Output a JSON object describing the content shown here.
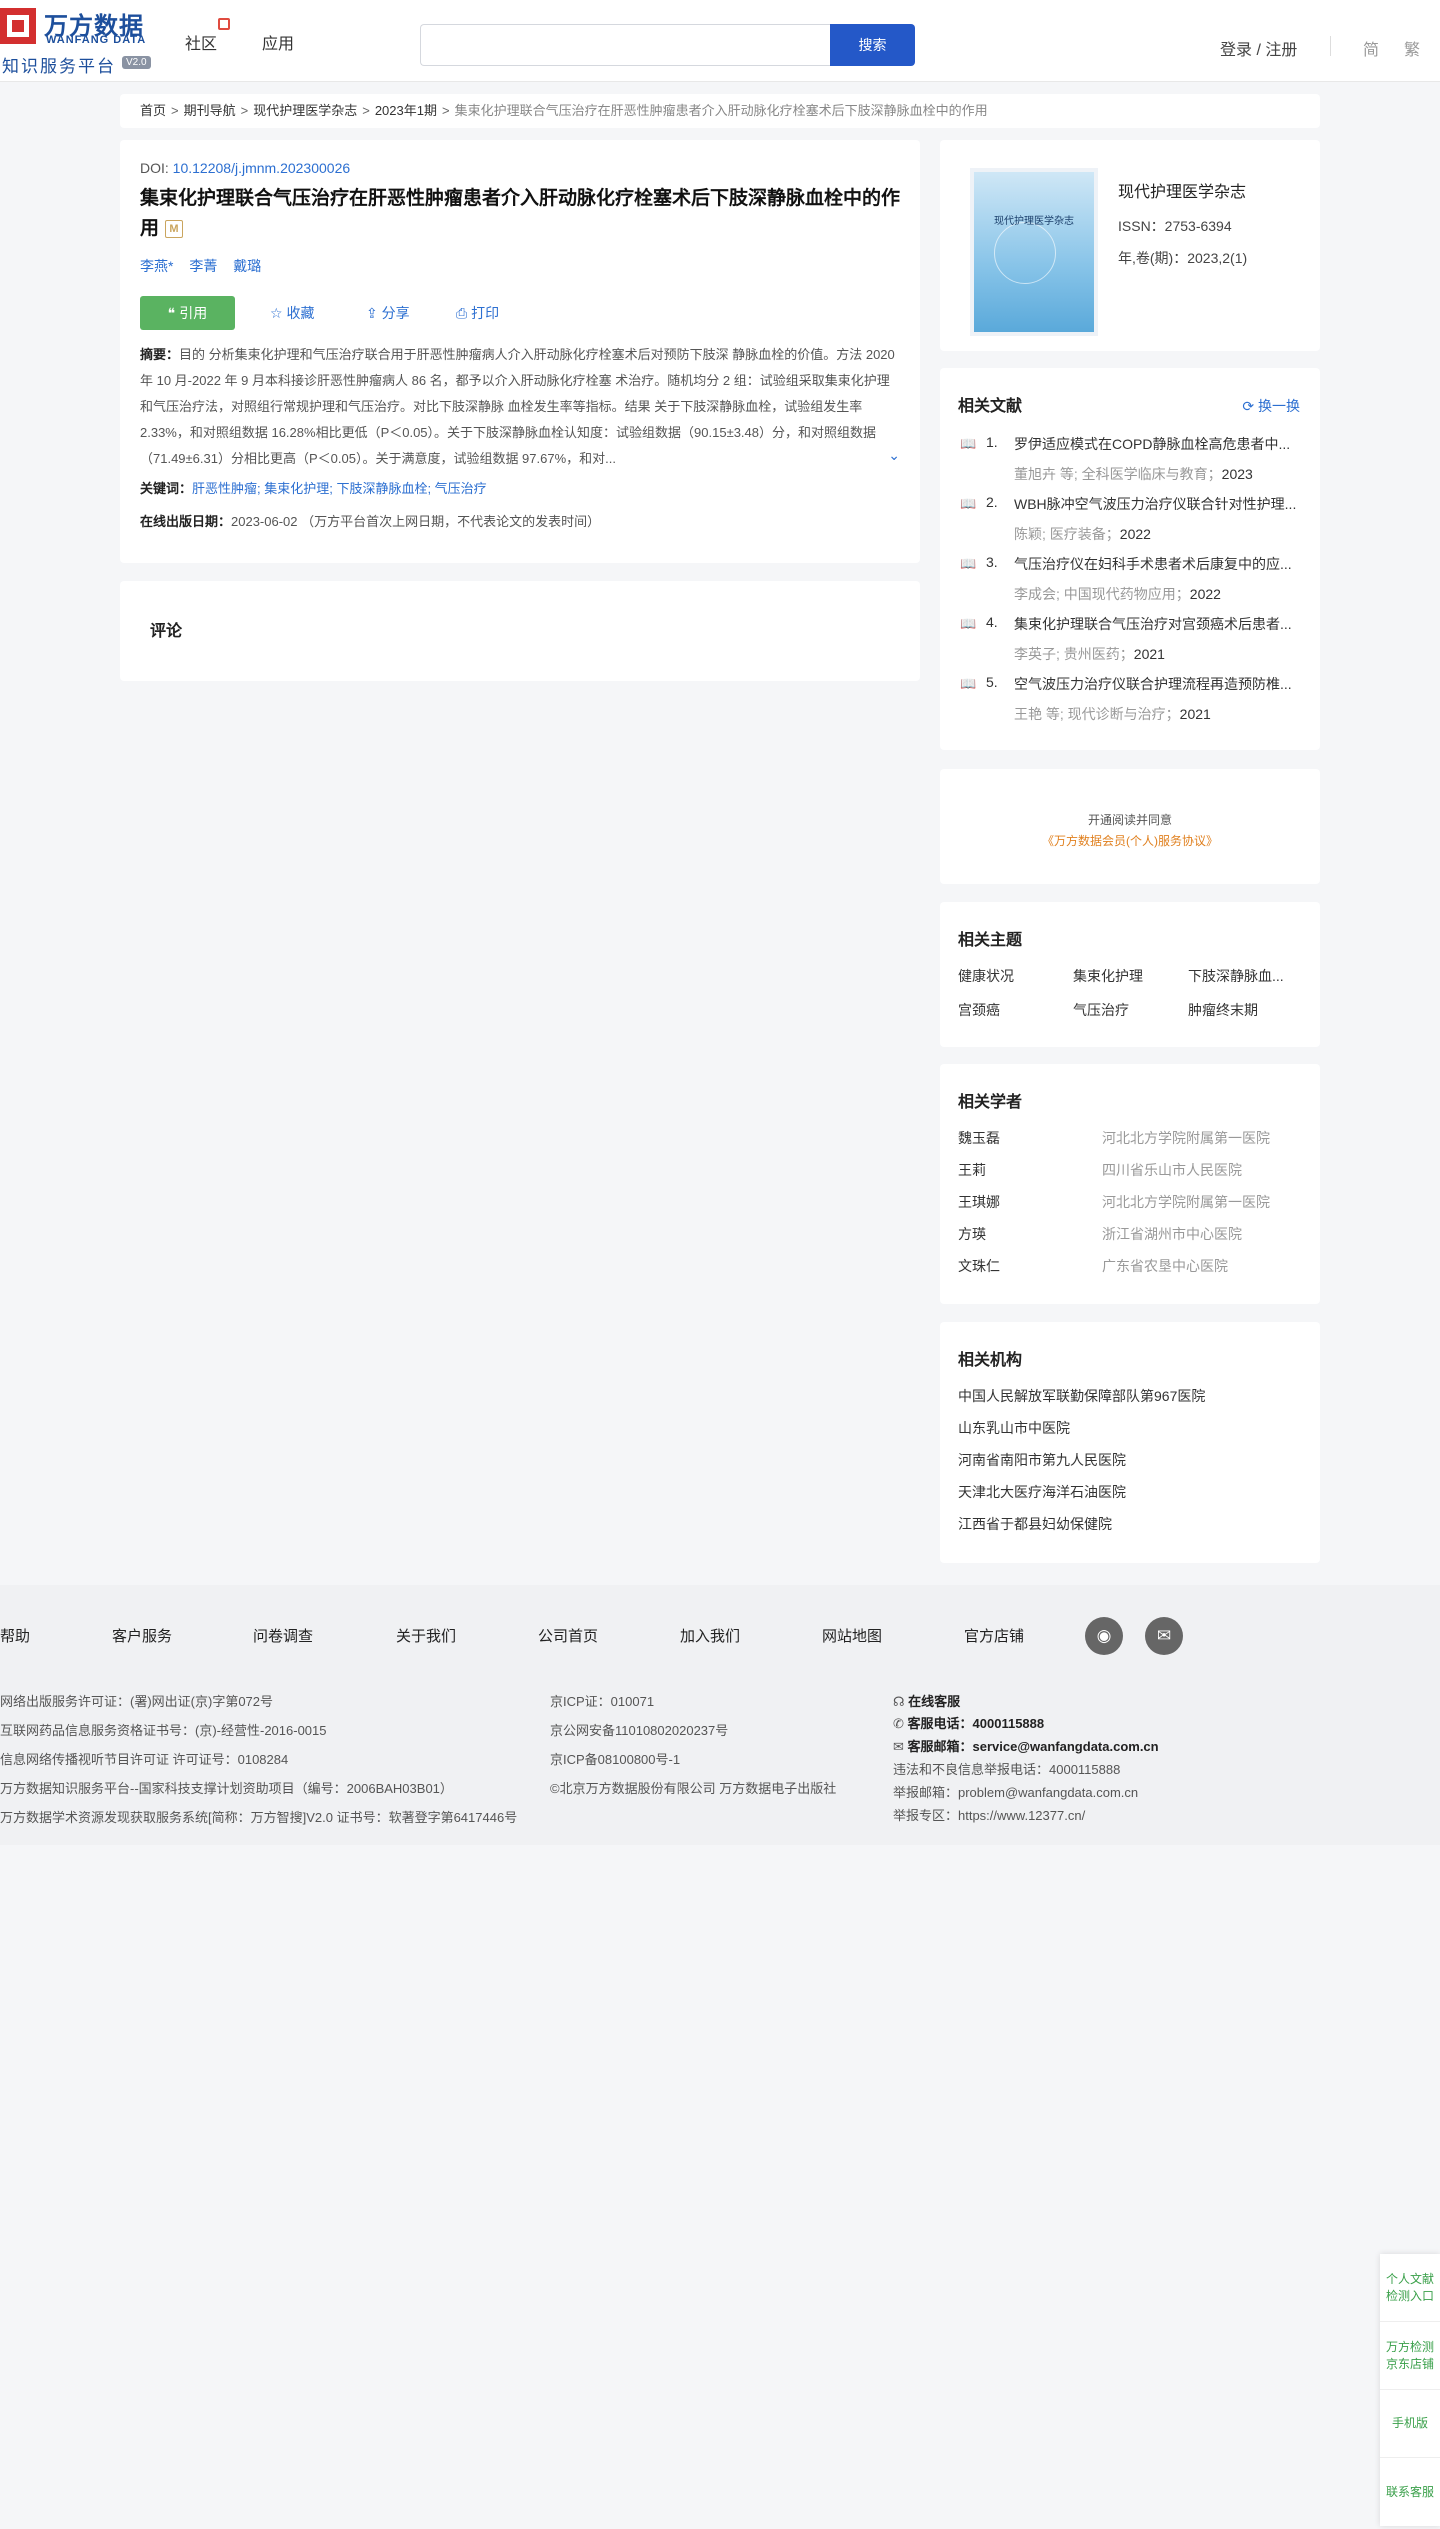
{
  "header": {
    "logo_cn": "万方数据",
    "logo_en": "WANFANG DATA",
    "logo_sub": "知识服务平台",
    "logo_version": "V2.0",
    "nav": [
      "社区",
      "应用"
    ],
    "search_placeholder": "",
    "search_button": "搜索",
    "login": "登录 / 注册",
    "lang_simplified": "简",
    "lang_traditional": "繁"
  },
  "breadcrumb": {
    "items": [
      "首页",
      "期刊导航",
      "现代护理医学杂志",
      "2023年1期"
    ],
    "current": "集束化护理联合气压治疗在肝恶性肿瘤患者介入肝动脉化疗栓塞术后下肢深静脉血栓中的作用"
  },
  "article": {
    "doi_label": "DOI: ",
    "doi": "10.12208/j.jmnm.202300026",
    "title": "集束化护理联合气压治疗在肝恶性肿瘤患者介入肝动脉化疗栓塞术后下肢深静脉血栓中的作用",
    "m_badge": "M",
    "authors": [
      "李燕*",
      "李菁",
      "戴璐"
    ],
    "cite_button": "引用",
    "collect": "收藏",
    "share": "分享",
    "print": "打印",
    "abstract_label": "摘要：",
    "abstract": "目的 分析集束化护理和气压治疗联合用于肝恶性肿瘤病人介入肝动脉化疗栓塞术后对预防下肢深 静脉血栓的价值。方法 2020 年 10 月-2022 年 9 月本科接诊肝恶性肿瘤病人 86 名，都予以介入肝动脉化疗栓塞 术治疗。随机均分 2 组：试验组采取集束化护理和气压治疗法，对照组行常规护理和气压治疗。对比下肢深静脉 血栓发生率等指标。结果 关于下肢深静脉血栓，试验组发生率 2.33%，和对照组数据 16.28%相比更低（P＜0.05）。关于下肢深静脉血栓认知度：试验组数据（90.15±3.48）分，和对照组数据（71.49±6.31）分相比更高（P＜0.05）。关于满意度，试验组数据 97.67%，和对...",
    "keywords_label": "关键词：",
    "keywords": "肝恶性肿瘤; 集束化护理; 下肢深静脉血栓; 气压治疗",
    "pubdate_label": "在线出版日期：",
    "pubdate": "2023-06-02 （万方平台首次上网日期，不代表论文的发表时间）"
  },
  "comment": {
    "title": "评论"
  },
  "journal": {
    "cover_text": "现代护理医学杂志",
    "name": "现代护理医学杂志",
    "issn": "ISSN：2753-6394",
    "volume": "年,卷(期)：2023,2(1)"
  },
  "related": {
    "title": "相关文献",
    "refresh": "换一换",
    "items": [
      {
        "num": "1.",
        "title": "罗伊适应模式在COPD静脉血栓高危患者中...",
        "meta": "董旭卉 等; 全科医学临床与教育；",
        "year": "2023"
      },
      {
        "num": "2.",
        "title": "WBH脉冲空气波压力治疗仪联合针对性护理...",
        "meta": "陈颖; 医疗装备；",
        "year": "2022"
      },
      {
        "num": "3.",
        "title": "气压治疗仪在妇科手术患者术后康复中的应...",
        "meta": "李成会; 中国现代药物应用；",
        "year": "2022"
      },
      {
        "num": "4.",
        "title": "集束化护理联合气压治疗对宫颈癌术后患者...",
        "meta": "李英子; 贵州医药；",
        "year": "2021"
      },
      {
        "num": "5.",
        "title": "空气波压力治疗仪联合护理流程再造预防椎...",
        "meta": "王艳 等; 现代诊断与治疗；",
        "year": "2021"
      }
    ]
  },
  "agreement": {
    "line1": "开通阅读并同意",
    "line2": "《万方数据会员(个人)服务协议》"
  },
  "topics": {
    "title": "相关主题",
    "items": [
      "健康状况",
      "集束化护理",
      "下肢深静脉血...",
      "宫颈癌",
      "气压治疗",
      "肿瘤终末期"
    ]
  },
  "scholars": {
    "title": "相关学者",
    "items": [
      {
        "name": "魏玉磊",
        "org": "河北北方学院附属第一医院"
      },
      {
        "name": "王莉",
        "org": "四川省乐山市人民医院"
      },
      {
        "name": "王琪娜",
        "org": "河北北方学院附属第一医院"
      },
      {
        "name": "方瑛",
        "org": "浙江省湖州市中心医院"
      },
      {
        "name": "文珠仁",
        "org": "广东省农垦中心医院"
      }
    ]
  },
  "orgs": {
    "title": "相关机构",
    "items": [
      "中国人民解放军联勤保障部队第967医院",
      "山东乳山市中医院",
      "河南省南阳市第九人民医院",
      "天津北大医疗海洋石油医院",
      "江西省于都县妇幼保健院"
    ]
  },
  "footer": {
    "links": [
      "帮助",
      "客户服务",
      "问卷调查",
      "关于我们",
      "公司首页",
      "加入我们",
      "网站地图",
      "官方店铺"
    ],
    "col1": [
      "网络出版服务许可证：(署)网出证(京)字第072号",
      "互联网药品信息服务资格证书号：(京)-经营性-2016-0015",
      "信息网络传播视听节目许可证 许可证号：0108284",
      "万方数据知识服务平台--国家科技支撑计划资助项目（编号：2006BAH03B01）",
      "万方数据学术资源发现获取服务系统[简称：万方智搜]V2.0 证书号：软著登字第6417446号"
    ],
    "col2": [
      "京ICP证：010071",
      "京公网安备11010802020237号",
      "京ICP备08100800号-1",
      "©北京万方数据股份有限公司 万方数据电子出版社"
    ],
    "online_service": "在线客服",
    "phone_label": "客服电话：",
    "phone": "4000115888",
    "email_label": "客服邮箱：",
    "email": "service@wanfangdata.com.cn",
    "report_phone": "违法和不良信息举报电话：4000115888",
    "report_email": "举报邮箱：problem@wanfangdata.com.cn",
    "report_site": "举报专区：https://www.12377.cn/"
  },
  "side": [
    "个人文献检测入口",
    "万方检测京东店铺",
    "手机版",
    "联系客服"
  ],
  "colors": {
    "primary": "#2458c8",
    "link": "#2c6fd1",
    "cite": "#5ab361",
    "side": "#3aa04a"
  }
}
